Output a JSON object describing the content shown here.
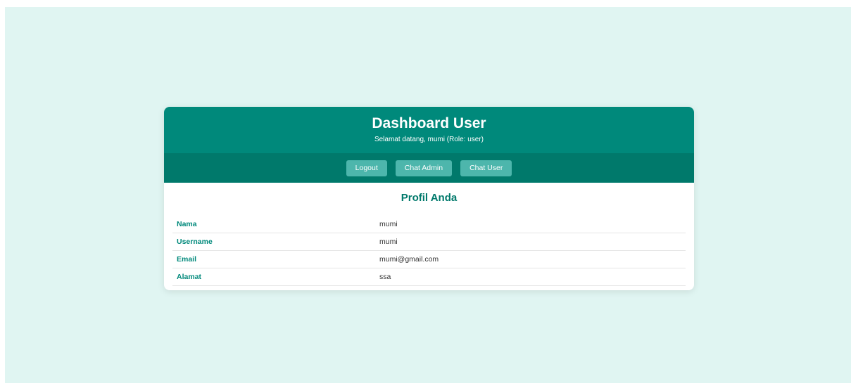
{
  "header": {
    "title": "Dashboard User",
    "subtitle": "Selamat datang, mumi (Role: user)"
  },
  "nav": {
    "logout_label": "Logout",
    "chat_admin_label": "Chat Admin",
    "chat_user_label": "Chat User"
  },
  "profile": {
    "heading": "Profil Anda",
    "rows": [
      {
        "label": "Nama",
        "value": "mumi"
      },
      {
        "label": "Username",
        "value": "mumi"
      },
      {
        "label": "Email",
        "value": "mumi@gmail.com"
      },
      {
        "label": "Alamat",
        "value": "ssa"
      }
    ]
  },
  "colors": {
    "page_background": "#e0f5f2",
    "header_background": "#00897b",
    "nav_background": "#00796b",
    "button_background": "#4db6ac",
    "accent_text": "#00796b"
  }
}
